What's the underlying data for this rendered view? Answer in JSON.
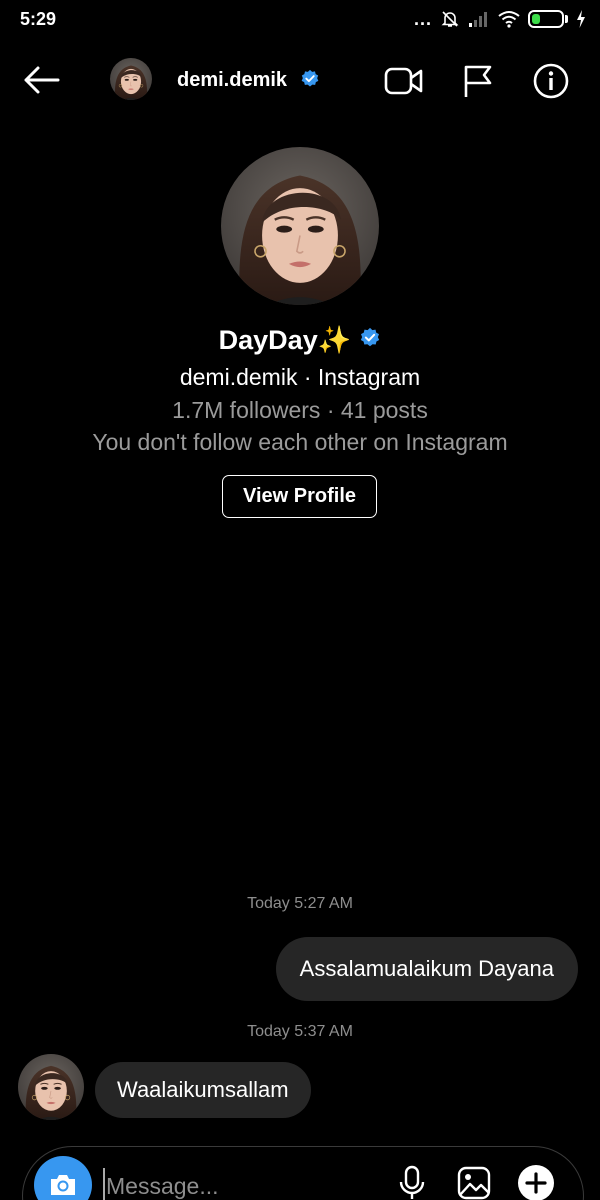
{
  "status_bar": {
    "time": "5:29",
    "dots": "...",
    "battery": "27",
    "battery_level": 0.27
  },
  "header": {
    "username": "demi.demik"
  },
  "profile": {
    "display_name": "DayDay✨",
    "handle_line": "demi.demik · Instagram",
    "stats": "1.7M followers · 41 posts",
    "follow_note": "You don't follow each other on Instagram",
    "view_profile_label": "View Profile"
  },
  "messages": [
    {
      "timestamp": "Today 5:27 AM",
      "direction": "outgoing",
      "text": "Assalamualaikum Dayana"
    },
    {
      "timestamp": "Today 5:37 AM",
      "direction": "incoming",
      "text": "Waalaikumsallam"
    }
  ],
  "composer": {
    "placeholder": "Message..."
  },
  "colors": {
    "accent": "#3797f0",
    "verified": "#3797f0",
    "bubble": "#262626",
    "secondary_text": "#9b9b9b",
    "battery": "#3ddc4a"
  },
  "icons": {
    "header": [
      "back-arrow-icon",
      "verified-badge-icon",
      "video-call-icon",
      "flag-icon",
      "info-icon"
    ],
    "composer": [
      "camera-icon",
      "microphone-icon",
      "gallery-icon",
      "plus-icon"
    ]
  }
}
